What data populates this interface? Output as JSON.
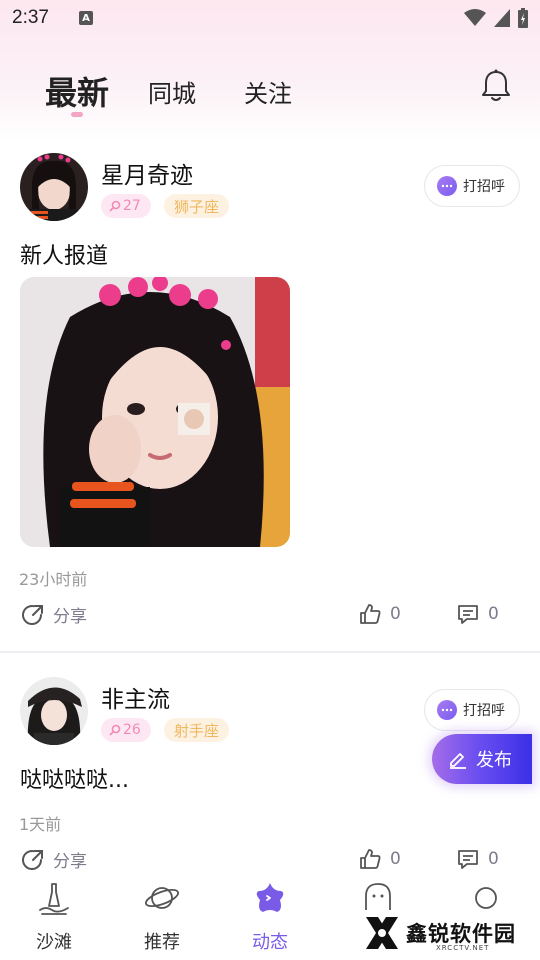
{
  "status_bar": {
    "time": "2:37",
    "indicator": "A"
  },
  "tabs": [
    {
      "label": "最新",
      "active": true
    },
    {
      "label": "同城",
      "active": false
    },
    {
      "label": "关注",
      "active": false
    }
  ],
  "header": {
    "bell_icon": "bell-icon"
  },
  "posts": [
    {
      "username": "星月奇迹",
      "level": "27",
      "zodiac": "狮子座",
      "greet_label": "打招呼",
      "text": "新人报道",
      "time": "23小时前",
      "share_label": "分享",
      "likes": "0",
      "comments": "0"
    },
    {
      "username": "非主流",
      "level": "26",
      "zodiac": "射手座",
      "greet_label": "打招呼",
      "text": "哒哒哒哒...",
      "time": "1天前",
      "share_label": "分享",
      "likes": "0",
      "comments": "0"
    }
  ],
  "publish_label": "发布",
  "bottom_nav": [
    {
      "label": "沙滩",
      "icon": "beach-icon",
      "active": false
    },
    {
      "label": "推荐",
      "icon": "planet-icon",
      "active": false
    },
    {
      "label": "动态",
      "icon": "star-icon",
      "active": true
    },
    {
      "label": "",
      "icon": "ghost-icon",
      "active": false
    },
    {
      "label": "",
      "icon": "profile-icon",
      "active": false
    }
  ],
  "watermark": {
    "text": "鑫锐软件园",
    "subtext": "XRCCTV.NET"
  },
  "colors": {
    "accent": "#7a5be8",
    "level_pink": "#f08bb8",
    "zodiac_gold": "#f0b85f",
    "muted": "#7c7c8c"
  }
}
